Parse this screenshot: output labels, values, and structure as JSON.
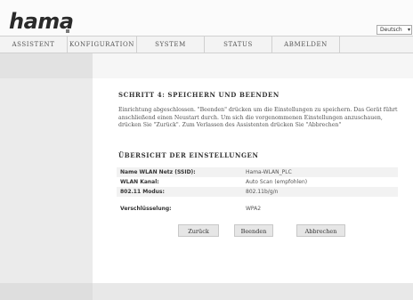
{
  "header": {
    "logo": "hama",
    "language": "Deutsch"
  },
  "nav": {
    "items": [
      {
        "label": "ASSISTENT"
      },
      {
        "label": "KONFIGURATION"
      },
      {
        "label": "SYSTEM"
      },
      {
        "label": "STATUS"
      },
      {
        "label": "ABMELDEN"
      }
    ]
  },
  "step": {
    "title": "SCHRITT 4: SPEICHERN UND BEENDEN",
    "description": "Einrichtung abgeschlossen. \"Beenden\" drücken um die Einstellungen zu speichern. Das Gerät führt anschließend einen Neustart durch. Um sich die vorgenommenen Einstellungen anzuschauen, drücken Sie \"Zurück\". Zum Verlassen des Assistenten drücken Sie \"Abbrechen\""
  },
  "overview": {
    "title": "ÜBERSICHT DER EINSTELLUNGEN",
    "rows": [
      {
        "label": "Name WLAN Netz (SSID):",
        "value": "Hama-WLAN_PLC"
      },
      {
        "label": "WLAN Kanal:",
        "value": "Auto Scan (empfohlen)"
      },
      {
        "label": "802.11 Modus:",
        "value": "802.11b/g/n"
      },
      {
        "label": "Verschlüsselung:",
        "value": "WPA2"
      }
    ]
  },
  "buttons": {
    "back": "Zurück",
    "finish": "Beenden",
    "cancel": "Abbrechen"
  }
}
